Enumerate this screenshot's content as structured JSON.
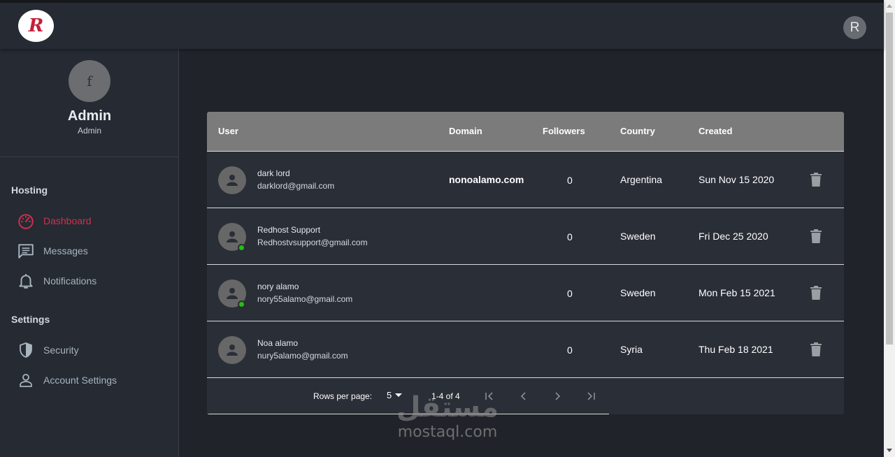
{
  "topbar": {
    "logo_letter": "R",
    "user_initial": "R"
  },
  "sidebar": {
    "profile": {
      "avatar_glyph": "f",
      "name": "Admin",
      "role": "Admin"
    },
    "sections": [
      {
        "title": "Hosting"
      },
      {
        "title": "Settings"
      }
    ],
    "items": [
      {
        "label": "Dashboard",
        "icon": "speedometer-icon",
        "active": true
      },
      {
        "label": "Messages",
        "icon": "message-icon"
      },
      {
        "label": "Notifications",
        "icon": "bell-icon"
      },
      {
        "label": "Security",
        "icon": "shield-icon"
      },
      {
        "label": "Account Settings",
        "icon": "person-icon"
      }
    ]
  },
  "table": {
    "columns": [
      "User",
      "Domain",
      "Followers",
      "Country",
      "Created"
    ],
    "rows": [
      {
        "name": "dark lord",
        "email": "darklord@gmail.com",
        "domain": "nonoalamo.com",
        "followers": "0",
        "country": "Argentina",
        "created": "Sun Nov 15 2020",
        "online": false
      },
      {
        "name": "Redhost Support",
        "email": "Redhostvsupport@gmail.com",
        "domain": "",
        "followers": "0",
        "country": "Sweden",
        "created": "Fri Dec 25 2020",
        "online": true
      },
      {
        "name": "nory alamo",
        "email": "nory55alamo@gmail.com",
        "domain": "",
        "followers": "0",
        "country": "Sweden",
        "created": "Mon Feb 15 2021",
        "online": true
      },
      {
        "name": "Noa alamo",
        "email": "nury5alamo@gmail.com",
        "domain": "",
        "followers": "0",
        "country": "Syria",
        "created": "Thu Feb 18 2021",
        "online": false
      }
    ],
    "pagination": {
      "rows_per_page_label": "Rows per page:",
      "rows_per_page": "5",
      "range": "1-4 of 4"
    }
  },
  "watermark": {
    "arabic": "مستقل",
    "latin": "mostaql.com"
  },
  "colors": {
    "accent": "#d1304c",
    "online": "#22c10f",
    "header": "#7b7b7b"
  }
}
